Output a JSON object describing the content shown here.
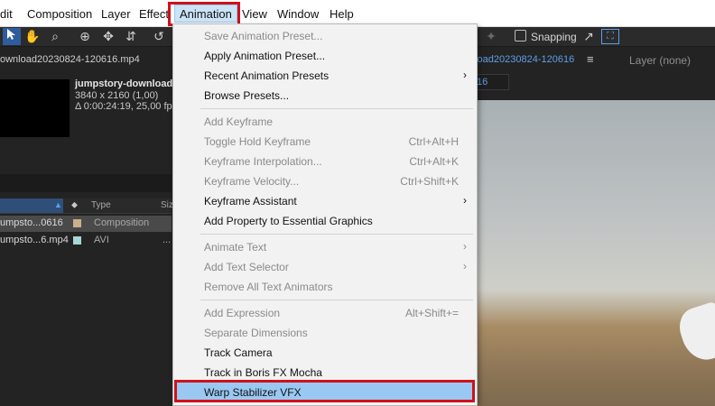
{
  "menubar": {
    "items": [
      "dit",
      "Composition",
      "Layer",
      "Effect",
      "Animation",
      "View",
      "Window",
      "Help"
    ],
    "active": "Animation"
  },
  "toolbar": {
    "tools": [
      "selection-tool",
      "hand-tool",
      "zoom-tool",
      "orbit-tool",
      "pan-tool",
      "dolly-tool",
      "rotate-tool"
    ],
    "snapping_label": "Snapping"
  },
  "project": {
    "title": "ownload20230824-120616.mp4",
    "item_name": "jumpstory-download",
    "resolution": "3840 x 2160 (1,00)",
    "duration": "Δ 0:00:24:19, 25,00 fps",
    "columns": {
      "type": "Type",
      "size": "Siz"
    },
    "rows": [
      {
        "name": "umpsto...0616",
        "type": "Composition",
        "size": "",
        "color": "#c8b08a"
      },
      {
        "name": "umpsto...6.mp4",
        "type": "AVI",
        "size": "...",
        "color": "#a6d6d6"
      }
    ]
  },
  "composition": {
    "tab_label": "nload20230824-120616",
    "layer_label": "Layer  (none)",
    "sub_tab": "16"
  },
  "dropdown": {
    "items": [
      {
        "label": "Save Animation Preset...",
        "shortcut": "",
        "disabled": true,
        "submenu": false
      },
      {
        "label": "Apply Animation Preset...",
        "shortcut": "",
        "disabled": false,
        "submenu": false
      },
      {
        "label": "Recent Animation Presets",
        "shortcut": "",
        "disabled": false,
        "submenu": true
      },
      {
        "label": "Browse Presets...",
        "shortcut": "",
        "disabled": false,
        "submenu": false
      },
      {
        "label": "Add Keyframe",
        "shortcut": "",
        "disabled": true,
        "submenu": false
      },
      {
        "label": "Toggle Hold Keyframe",
        "shortcut": "Ctrl+Alt+H",
        "disabled": true,
        "submenu": false
      },
      {
        "label": "Keyframe Interpolation...",
        "shortcut": "Ctrl+Alt+K",
        "disabled": true,
        "submenu": false
      },
      {
        "label": "Keyframe Velocity...",
        "shortcut": "Ctrl+Shift+K",
        "disabled": true,
        "submenu": false
      },
      {
        "label": "Keyframe Assistant",
        "shortcut": "",
        "disabled": false,
        "submenu": true
      },
      {
        "label": "Add Property to Essential Graphics",
        "shortcut": "",
        "disabled": false,
        "submenu": false
      },
      {
        "label": "Animate Text",
        "shortcut": "",
        "disabled": true,
        "submenu": true
      },
      {
        "label": "Add Text Selector",
        "shortcut": "",
        "disabled": true,
        "submenu": true
      },
      {
        "label": "Remove All Text Animators",
        "shortcut": "",
        "disabled": true,
        "submenu": false
      },
      {
        "label": "Add Expression",
        "shortcut": "Alt+Shift+=",
        "disabled": true,
        "submenu": false
      },
      {
        "label": "Separate Dimensions",
        "shortcut": "",
        "disabled": true,
        "submenu": false
      },
      {
        "label": "Track Camera",
        "shortcut": "",
        "disabled": false,
        "submenu": false
      },
      {
        "label": "Track in Boris FX Mocha",
        "shortcut": "",
        "disabled": false,
        "submenu": false
      },
      {
        "label": "Warp Stabilizer VFX",
        "shortcut": "",
        "disabled": false,
        "submenu": false,
        "highlighted": true
      }
    ]
  },
  "colors": {
    "highlight_box": "#d0111b",
    "menu_highlight": "#99c9f3",
    "comp_tab_blue": "#5d9fe6"
  }
}
